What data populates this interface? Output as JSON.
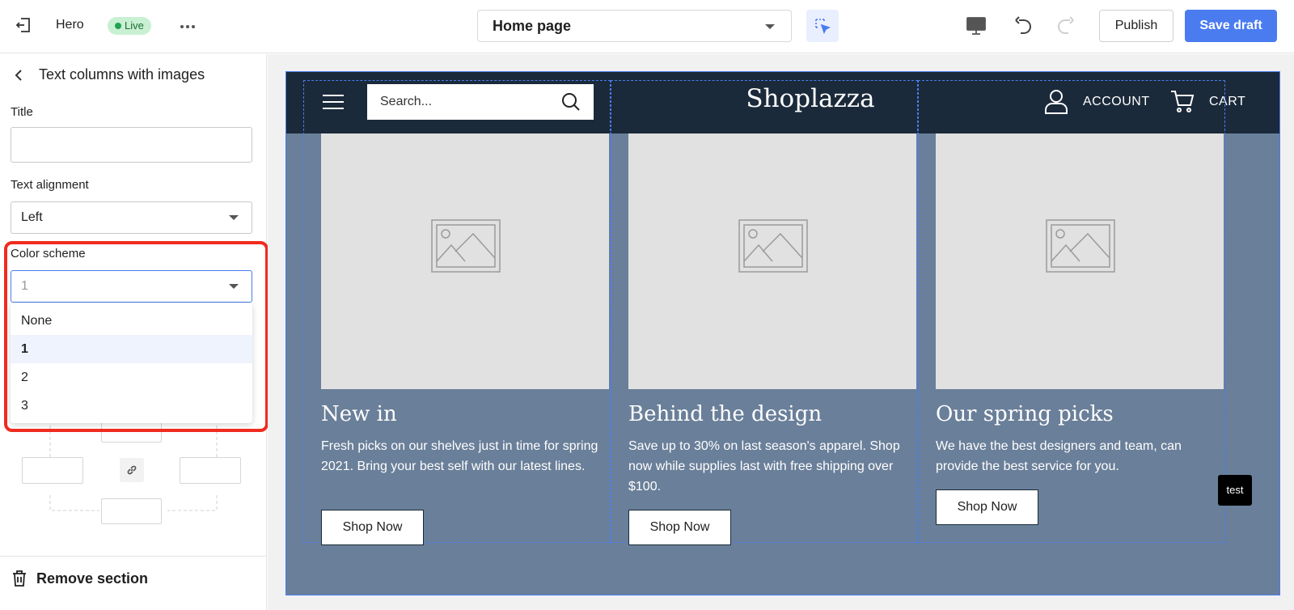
{
  "topbar": {
    "theme_name": "Hero",
    "live_badge": "Live",
    "page_select": "Home page",
    "publish_label": "Publish",
    "save_label": "Save draft",
    "accent_color": "#4a7cf0"
  },
  "sidebar": {
    "section_title": "Text columns with images",
    "title_label": "Title",
    "title_value": "",
    "alignment_label": "Text alignment",
    "alignment_value": "Left",
    "scheme_label": "Color scheme",
    "scheme_value": "1",
    "scheme_options": [
      "None",
      "1",
      "2",
      "3"
    ],
    "scheme_selected": "1",
    "remove_label": "Remove section"
  },
  "preview": {
    "search_placeholder": "Search...",
    "logo": "Shoplazza",
    "account_label": "ACCOUNT",
    "cart_label": "CART",
    "columns": [
      {
        "heading": "New in",
        "text": "Fresh picks on our shelves just in time for spring 2021. Bring your best self with our latest lines.",
        "button": "Shop Now"
      },
      {
        "heading": "Behind the design",
        "text": "Save up to 30% on last season's apparel. Shop now while supplies last with free shipping over $100.",
        "button": "Shop Now"
      },
      {
        "heading": "Our spring picks",
        "text": "We have the best designers and team, can provide the best service for you.",
        "button": "Shop Now"
      }
    ],
    "test_tag": "test",
    "bg_color": "#6a7f99",
    "header_color": "#1b2a3a"
  }
}
